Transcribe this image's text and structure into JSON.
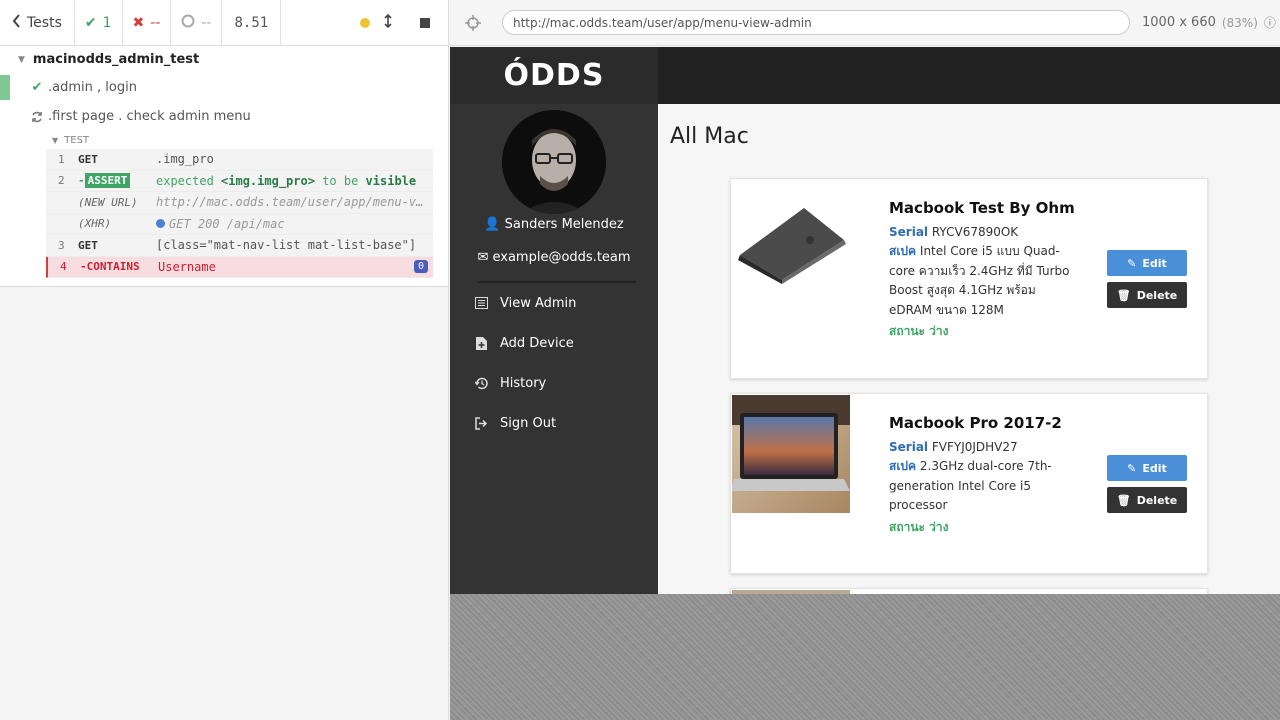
{
  "reporter": {
    "tests_label": "Tests",
    "passed": "1",
    "failed": "--",
    "pending": "--",
    "duration": "8.51"
  },
  "suite": {
    "title": "macinodds_admin_test",
    "tests": [
      {
        "label": ".admin , login",
        "state": "passed"
      },
      {
        "label": ".first page . check admin menu",
        "state": "running"
      }
    ],
    "hook_title": "TEST",
    "commands": [
      {
        "num": "1",
        "name": "GET",
        "msg": ".img_pro"
      },
      {
        "num": "2",
        "name": "-ASSERT",
        "msg_pre": "expected",
        "msg_el": "<img.img_pro>",
        "msg_mid": "to be",
        "msg_end": "visible"
      },
      {
        "num": "",
        "name": "(NEW URL)",
        "msg": "http://mac.odds.team/user/app/menu-v..."
      },
      {
        "num": "",
        "name": "(XHR)",
        "msg": "GET 200 /api/mac"
      },
      {
        "num": "3",
        "name": "GET",
        "msg": "[class=\"mat-nav-list mat-list-base\"]"
      },
      {
        "num": "4",
        "name": "-CONTAINS",
        "msg": "Username",
        "badge": "0"
      }
    ]
  },
  "aut_header": {
    "url": "http://mac.odds.team/user/app/menu-view-admin",
    "viewport": "1000 x 660",
    "scale": "(83%)"
  },
  "app": {
    "logo": "ÓDDS",
    "user": {
      "name": "Sanders Melendez",
      "email": "example@odds.team"
    },
    "nav": [
      {
        "label": "View Admin",
        "icon": "list-icon"
      },
      {
        "label": "Add Device",
        "icon": "file-plus-icon"
      },
      {
        "label": "History",
        "icon": "history-icon"
      },
      {
        "label": "Sign Out",
        "icon": "sign-out-icon"
      }
    ],
    "page_title": "All Mac",
    "edit_label": "Edit",
    "delete_label": "Delete",
    "devices": [
      {
        "name": "Macbook Test By Ohm",
        "serial_label": "Serial",
        "serial": "RYCV67890OK",
        "spec_label": "สเปค",
        "spec": "Intel Core i5 แบบ Quad-core ความเร็ว 2.4GHz ที่มี Turbo Boost สูงสุด 4.1GHz พร้อม eDRAM ขนาด 128M",
        "status": "สถานะ ว่าง"
      },
      {
        "name": "Macbook Pro 2017-2",
        "serial_label": "Serial",
        "serial": "FVFYJ0JDHV27",
        "spec_label": "สเปค",
        "spec": "2.3GHz dual-core 7th-generation Intel Core i5 processor",
        "status": "สถานะ ว่าง"
      }
    ]
  },
  "colors": {
    "pass": "#3fa565",
    "fail": "#d43f3f",
    "accent_blue": "#4a90d9",
    "sidebar": "#333333",
    "topbar": "#222222"
  }
}
